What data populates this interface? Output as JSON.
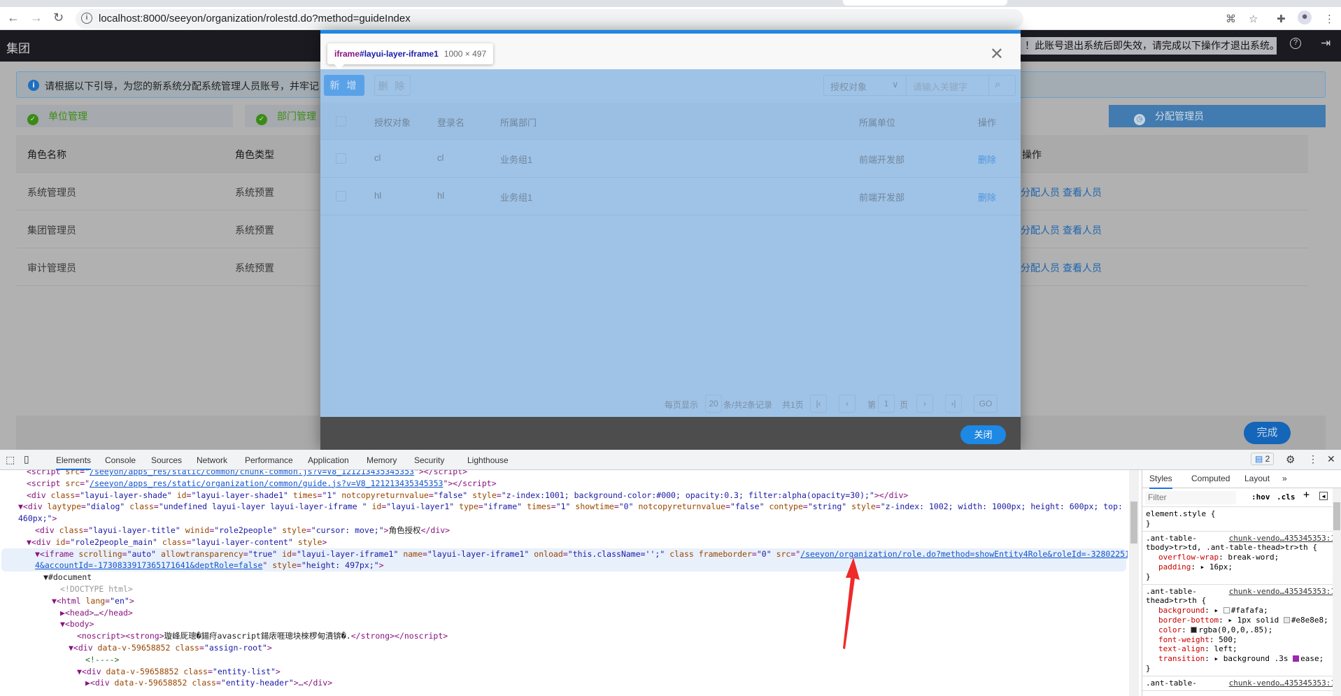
{
  "browser": {
    "url": "localhost:8000/seeyon/organization/rolestd.do?method=guideIndex"
  },
  "app": {
    "brand": "集团",
    "warning": "！此账号退出系统后即失效，请完成以下操作才退出系统。",
    "notice": "请根据以下引导，为您的新系统分配系统管理人员账号，并牢记；",
    "steps": [
      {
        "label": "单位管理"
      },
      {
        "label": "部门管理"
      },
      {
        "label": "分配管理员"
      }
    ],
    "table": {
      "headers": [
        "角色名称",
        "角色类型",
        "操作"
      ],
      "rows": [
        {
          "name": "系统管理员",
          "type": "系统预置",
          "a1": "分配人员",
          "a2": "查看人员"
        },
        {
          "name": "集团管理员",
          "type": "系统预置",
          "a1": "分配人员",
          "a2": "查看人员"
        },
        {
          "name": "审计管理员",
          "type": "系统预置",
          "a1": "分配人员",
          "a2": "查看人员"
        }
      ]
    },
    "done": "完成"
  },
  "modal": {
    "add": "新 增",
    "delete": "删 除",
    "select": "授权对象",
    "search_placeholder": "请输入关键字",
    "headers": [
      "授权对象",
      "登录名",
      "所属部门",
      "所属单位",
      "操作"
    ],
    "rows": [
      {
        "obj": "cl",
        "login": "cl",
        "dept": "业务组1",
        "unit": "前端开发部",
        "op": "删除"
      },
      {
        "obj": "hl",
        "login": "hl",
        "dept": "业务组1",
        "unit": "前端开发部",
        "op": "删除"
      }
    ],
    "pager": {
      "per_page_label": "每页显示",
      "per_page": "20",
      "summary": "条/共2条记录",
      "pages": "共1页",
      "page_prefix": "第",
      "page": "1",
      "page_suffix": "页",
      "go": "GO"
    },
    "close": "关闭"
  },
  "tooltip": {
    "tag": "iframe",
    "id": "#layui-layer-iframe1",
    "size": "1000 × 497"
  },
  "devtools": {
    "tabs": [
      "Elements",
      "Console",
      "Sources",
      "Network",
      "Performance",
      "Application",
      "Memory",
      "Security",
      "Lighthouse"
    ],
    "issues": "2",
    "styles_tabs": [
      "Styles",
      "Computed",
      "Layout"
    ],
    "filter": "Filter",
    "hov": ":hov",
    "cls": ".cls"
  }
}
